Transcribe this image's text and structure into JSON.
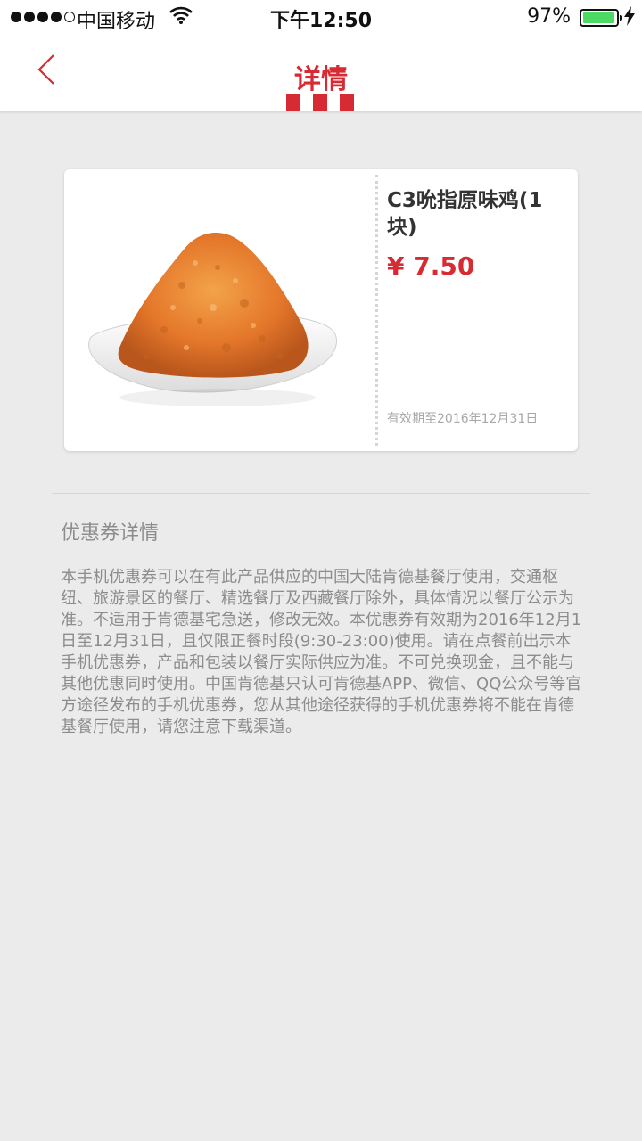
{
  "status_bar": {
    "carrier": "中国移动",
    "time": "下午12:50",
    "battery_percent": "97%",
    "battery_level": 0.97,
    "signal_bars": 4,
    "signal_max": 5
  },
  "nav": {
    "title": "详情",
    "back_icon": "chevron-left-icon",
    "accent_color": "#d62b33"
  },
  "coupon": {
    "name": "C3吮指原味鸡(1块)",
    "price": "¥ 7.50",
    "expiry": "有效期至2016年12月31日",
    "image": "fried-chicken-on-plate"
  },
  "details": {
    "heading": "优惠券详情",
    "body": "本手机优惠券可以在有此产品供应的中国大陆肯德基餐厅使用，交通枢纽、旅游景区的餐厅、精选餐厅及西藏餐厅除外，具体情况以餐厅公示为准。不适用于肯德基宅急送，修改无效。本优惠券有效期为2016年12月1日至12月31日，且仅限正餐时段(9:30-23:00)使用。请在点餐前出示本手机优惠券，产品和包装以餐厅实际供应为准。不可兑换现金，且不能与其他优惠同时使用。中国肯德基只认可肯德基APP、微信、QQ公众号等官方途径发布的手机优惠券，您从其他途径获得的手机优惠券将不能在肯德基餐厅使用，请您注意下载渠道。"
  }
}
